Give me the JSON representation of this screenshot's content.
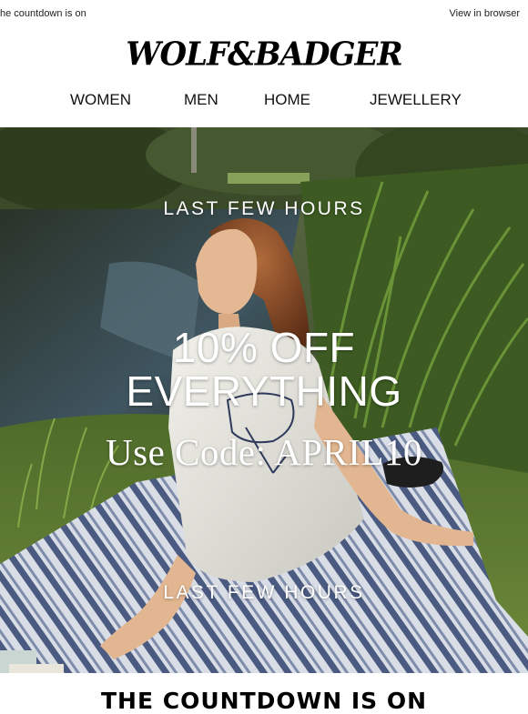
{
  "preheader": {
    "left_text": "he countdown is on",
    "view_in_browser": "View in browser"
  },
  "logo": {
    "text": "WOLF&BADGER"
  },
  "nav": {
    "items": [
      {
        "label": "WOMEN"
      },
      {
        "label": "MEN"
      },
      {
        "label": "HOME"
      },
      {
        "label": "JEWELLERY"
      }
    ]
  },
  "hero": {
    "kicker_top": "LAST FEW HOURS",
    "headline_line1": "10% OFF",
    "headline_line2": "EVERYTHING",
    "code_text": "Use Code: APRIL10",
    "kicker_bottom": "LAST FEW HOURS"
  },
  "section": {
    "heading": "THE COUNTDOWN IS ON"
  }
}
